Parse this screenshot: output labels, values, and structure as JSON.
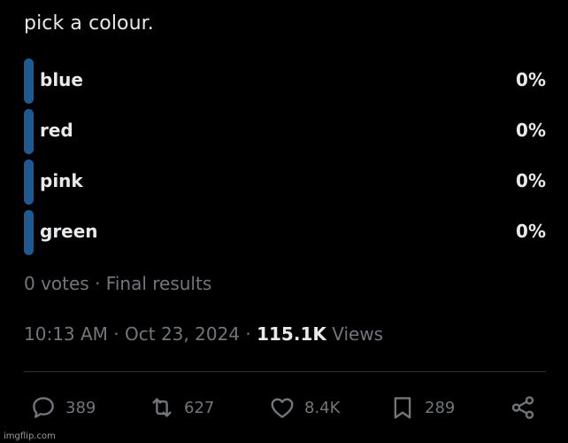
{
  "post": {
    "text": "pick a colour."
  },
  "poll": {
    "options": [
      {
        "label": "blue",
        "percent": "0%"
      },
      {
        "label": "red",
        "percent": "0%"
      },
      {
        "label": "pink",
        "percent": "0%"
      },
      {
        "label": "green",
        "percent": "0%"
      }
    ],
    "votes_text": "0 votes · Final results",
    "bar_color": "#1d5a93"
  },
  "meta": {
    "time": "10:13 AM",
    "separator": " · ",
    "date": "Oct 23, 2024",
    "views_count": "115.1K",
    "views_label": " Views"
  },
  "actions": {
    "replies": {
      "icon": "reply-icon",
      "count": "389"
    },
    "reposts": {
      "icon": "repost-icon",
      "count": "627"
    },
    "likes": {
      "icon": "heart-icon",
      "count": "8.4K"
    },
    "bookmarks": {
      "icon": "bookmark-icon",
      "count": "289"
    },
    "share": {
      "icon": "share-icon"
    }
  },
  "watermark": "imgflip.com",
  "colors": {
    "background": "#000000",
    "text_primary": "#e7e9ea",
    "text_secondary": "#71767b",
    "divider": "#2f3336"
  }
}
